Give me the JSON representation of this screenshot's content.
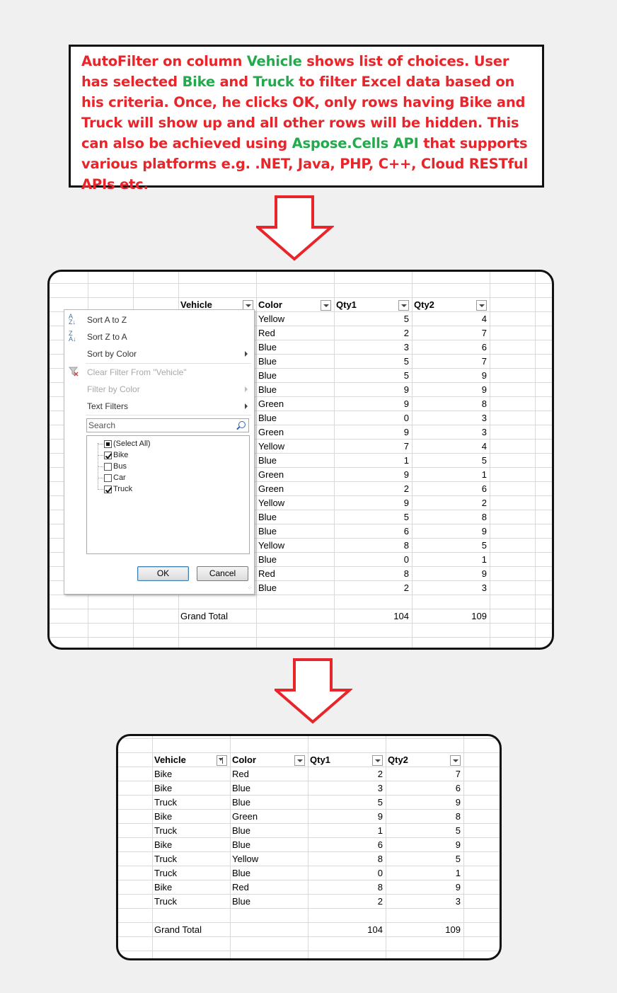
{
  "caption": {
    "segments": [
      {
        "text": "AutoFilter on column ",
        "color": "red"
      },
      {
        "text": "Vehicle",
        "color": "green"
      },
      {
        "text": " shows list of choices. User has selected ",
        "color": "red"
      },
      {
        "text": "Bike",
        "color": "green"
      },
      {
        "text": " and ",
        "color": "red"
      },
      {
        "text": "Truck",
        "color": "green"
      },
      {
        "text": " to filter Excel data based on his criteria. Once, he clicks OK, only rows having Bike and Truck will show up and all other rows will be hidden. This can also be achieved using ",
        "color": "red"
      },
      {
        "text": "Aspose.Cells API",
        "color": "green"
      },
      {
        "text": " that supports various platforms e.g. .NET, Java, PHP, C++, Cloud RESTful APIs etc.",
        "color": "red"
      }
    ],
    "colors": {
      "red": "#e8252b",
      "green": "#22aa4c"
    }
  },
  "arrow_color": "#e8252b",
  "sheet1": {
    "headers": [
      "Vehicle",
      "Color",
      "Qty1",
      "Qty2"
    ],
    "rows": [
      [
        "Yellow",
        "5",
        "4"
      ],
      [
        "Red",
        "2",
        "7"
      ],
      [
        "Blue",
        "3",
        "6"
      ],
      [
        "Blue",
        "5",
        "7"
      ],
      [
        "Blue",
        "5",
        "9"
      ],
      [
        "Blue",
        "9",
        "9"
      ],
      [
        "Green",
        "9",
        "8"
      ],
      [
        "Blue",
        "0",
        "3"
      ],
      [
        "Green",
        "9",
        "3"
      ],
      [
        "Yellow",
        "7",
        "4"
      ],
      [
        "Blue",
        "1",
        "5"
      ],
      [
        "Green",
        "9",
        "1"
      ],
      [
        "Green",
        "2",
        "6"
      ],
      [
        "Yellow",
        "9",
        "2"
      ],
      [
        "Blue",
        "5",
        "8"
      ],
      [
        "Blue",
        "6",
        "9"
      ],
      [
        "Yellow",
        "8",
        "5"
      ],
      [
        "Blue",
        "0",
        "1"
      ],
      [
        "Red",
        "8",
        "9"
      ],
      [
        "Blue",
        "2",
        "3"
      ]
    ],
    "total": {
      "label": "Grand Total",
      "qty1": "104",
      "qty2": "109"
    }
  },
  "filter_menu": {
    "sort_az": "Sort A to Z",
    "sort_za": "Sort Z to A",
    "sort_by_color": "Sort by Color",
    "clear_filter": "Clear Filter From \"Vehicle\"",
    "filter_by_color": "Filter by Color",
    "text_filters": "Text Filters",
    "search_placeholder": "Search",
    "items": [
      {
        "label": "(Select All)",
        "state": "partial"
      },
      {
        "label": "Bike",
        "state": "checked"
      },
      {
        "label": "Bus",
        "state": "unchecked"
      },
      {
        "label": "Car",
        "state": "unchecked"
      },
      {
        "label": "Truck",
        "state": "checked"
      }
    ],
    "ok_label": "OK",
    "cancel_label": "Cancel"
  },
  "sheet2": {
    "headers": [
      "Vehicle",
      "Color",
      "Qty1",
      "Qty2"
    ],
    "rows": [
      [
        "Bike",
        "Red",
        "2",
        "7"
      ],
      [
        "Bike",
        "Blue",
        "3",
        "6"
      ],
      [
        "Truck",
        "Blue",
        "5",
        "9"
      ],
      [
        "Bike",
        "Green",
        "9",
        "8"
      ],
      [
        "Truck",
        "Blue",
        "1",
        "5"
      ],
      [
        "Bike",
        "Blue",
        "6",
        "9"
      ],
      [
        "Truck",
        "Yellow",
        "8",
        "5"
      ],
      [
        "Truck",
        "Blue",
        "0",
        "1"
      ],
      [
        "Bike",
        "Red",
        "8",
        "9"
      ],
      [
        "Truck",
        "Blue",
        "2",
        "3"
      ]
    ],
    "total": {
      "label": "Grand Total",
      "qty1": "104",
      "qty2": "109"
    }
  }
}
